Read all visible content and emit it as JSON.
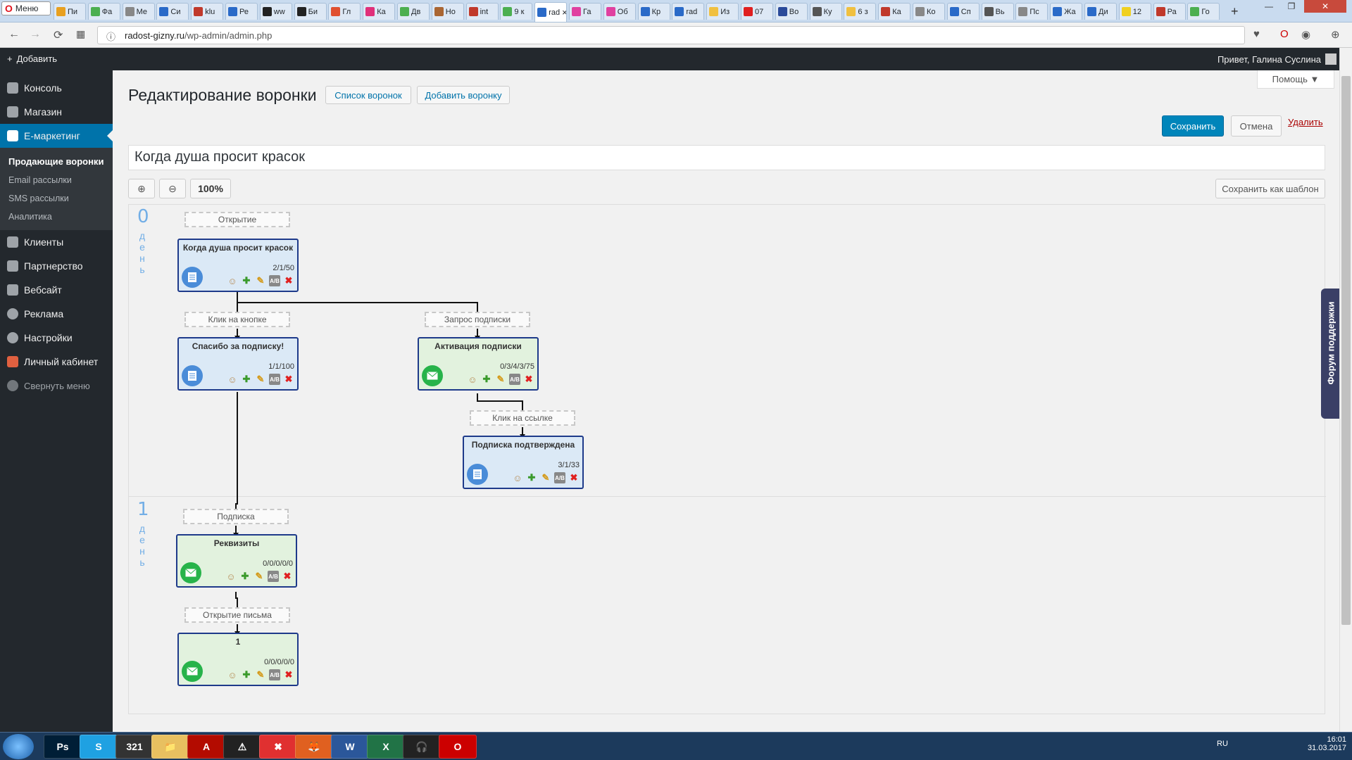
{
  "browser": {
    "menu_label": "Меню",
    "tabs": [
      {
        "label": "Пи",
        "color": "#e8a020"
      },
      {
        "label": "Фа",
        "color": "#4caf50"
      },
      {
        "label": "Ме",
        "color": "#888888"
      },
      {
        "label": "Си",
        "color": "#2a6ac8"
      },
      {
        "label": "klu",
        "color": "#c0392b"
      },
      {
        "label": "Ре",
        "color": "#2a6ac8"
      },
      {
        "label": "ww",
        "color": "#222222"
      },
      {
        "label": "Би",
        "color": "#222222"
      },
      {
        "label": "Гл",
        "color": "#e05030"
      },
      {
        "label": "Ка",
        "color": "#e0307a"
      },
      {
        "label": "Дв",
        "color": "#4caf50"
      },
      {
        "label": "Но",
        "color": "#aa6633"
      },
      {
        "label": "int",
        "color": "#c0392b"
      },
      {
        "label": "9 к",
        "color": "#4caf50"
      },
      {
        "label": "rad",
        "color": "#2a6ac8",
        "active": true
      },
      {
        "label": "Га",
        "color": "#e040a0"
      },
      {
        "label": "Об",
        "color": "#e040a0"
      },
      {
        "label": "Кр",
        "color": "#2a6ac8"
      },
      {
        "label": "rad",
        "color": "#2a6ac8"
      },
      {
        "label": "Из",
        "color": "#f0c040"
      },
      {
        "label": "07",
        "color": "#e02020"
      },
      {
        "label": "Во",
        "color": "#2a4a9a"
      },
      {
        "label": "Ку",
        "color": "#555555"
      },
      {
        "label": "6 з",
        "color": "#f0c040"
      },
      {
        "label": "Ка",
        "color": "#c0392b"
      },
      {
        "label": "Ко",
        "color": "#888888"
      },
      {
        "label": "Сп",
        "color": "#2a6ac8"
      },
      {
        "label": "Вь",
        "color": "#555555"
      },
      {
        "label": "Пс",
        "color": "#888888"
      },
      {
        "label": "Жа",
        "color": "#2a6ac8"
      },
      {
        "label": "Ди",
        "color": "#2a6ac8"
      },
      {
        "label": "12",
        "color": "#f0d020"
      },
      {
        "label": "Ра",
        "color": "#c0392b"
      },
      {
        "label": "Го",
        "color": "#4caf50"
      }
    ],
    "url_domain": "radost-gizny.ru",
    "url_path": "/wp-admin/admin.php"
  },
  "wpbar": {
    "add_label": "Добавить",
    "greeting": "Привет, Галина Суслина"
  },
  "sidebar": {
    "items_top": [
      {
        "label": "Консоль"
      },
      {
        "label": "Магазин"
      },
      {
        "label": "Е-маркетинг"
      }
    ],
    "submenu": [
      {
        "label": "Продающие воронки"
      },
      {
        "label": "Email рассылки"
      },
      {
        "label": "SMS рассылки"
      },
      {
        "label": "Аналитика"
      }
    ],
    "items_bottom": [
      {
        "label": "Клиенты"
      },
      {
        "label": "Партнерство"
      },
      {
        "label": "Вебсайт"
      },
      {
        "label": "Реклама"
      },
      {
        "label": "Настройки"
      },
      {
        "label": "Личный кабинет"
      }
    ],
    "collapse_label": "Свернуть меню"
  },
  "page": {
    "help_label": "Помощь ▼",
    "title": "Редактирование воронки",
    "list_button": "Список воронок",
    "add_button": "Добавить воронку",
    "save_button": "Сохранить",
    "cancel_button": "Отмена",
    "delete_link": "Удалить",
    "funnel_name": "Когда душа просит красок",
    "zoom_in": "⊕",
    "zoom_out": "⊖",
    "zoom_level": "100%",
    "save_template": "Сохранить как шаблон"
  },
  "funnel": {
    "days": [
      {
        "num": "0",
        "word": "день"
      },
      {
        "num": "1",
        "word": "день"
      }
    ],
    "events": {
      "open": "Открытие",
      "button_click": "Клик на кнопке",
      "sub_request": "Запрос подписки",
      "link_click": "Клик на ссылке",
      "subscription": "Подписка",
      "letter_open": "Открытие письма"
    },
    "nodes": {
      "n1": {
        "title": "Когда душа просит красок",
        "stat": "2/1/50"
      },
      "n2": {
        "title": "Спасибо за подписку!",
        "stat": "1/1/100"
      },
      "n3": {
        "title": "Активация подписки",
        "stat": "0/3/4/3/75"
      },
      "n4": {
        "title": "Подписка подтверждена",
        "stat": "3/1/33"
      },
      "n5": {
        "title": "Реквизиты",
        "stat": "0/0/0/0/0"
      },
      "n6": {
        "title": "1",
        "stat": "0/0/0/0/0"
      }
    }
  },
  "support": {
    "label": "Форум поддержки"
  },
  "taskbar": {
    "apps": [
      "Ps",
      "S",
      "321",
      "📁",
      "A",
      "⚠",
      "✖",
      "🦊",
      "W",
      "X",
      "🎧",
      "O"
    ],
    "lang": "RU",
    "time": "16:01",
    "date": "31.03.2017"
  }
}
